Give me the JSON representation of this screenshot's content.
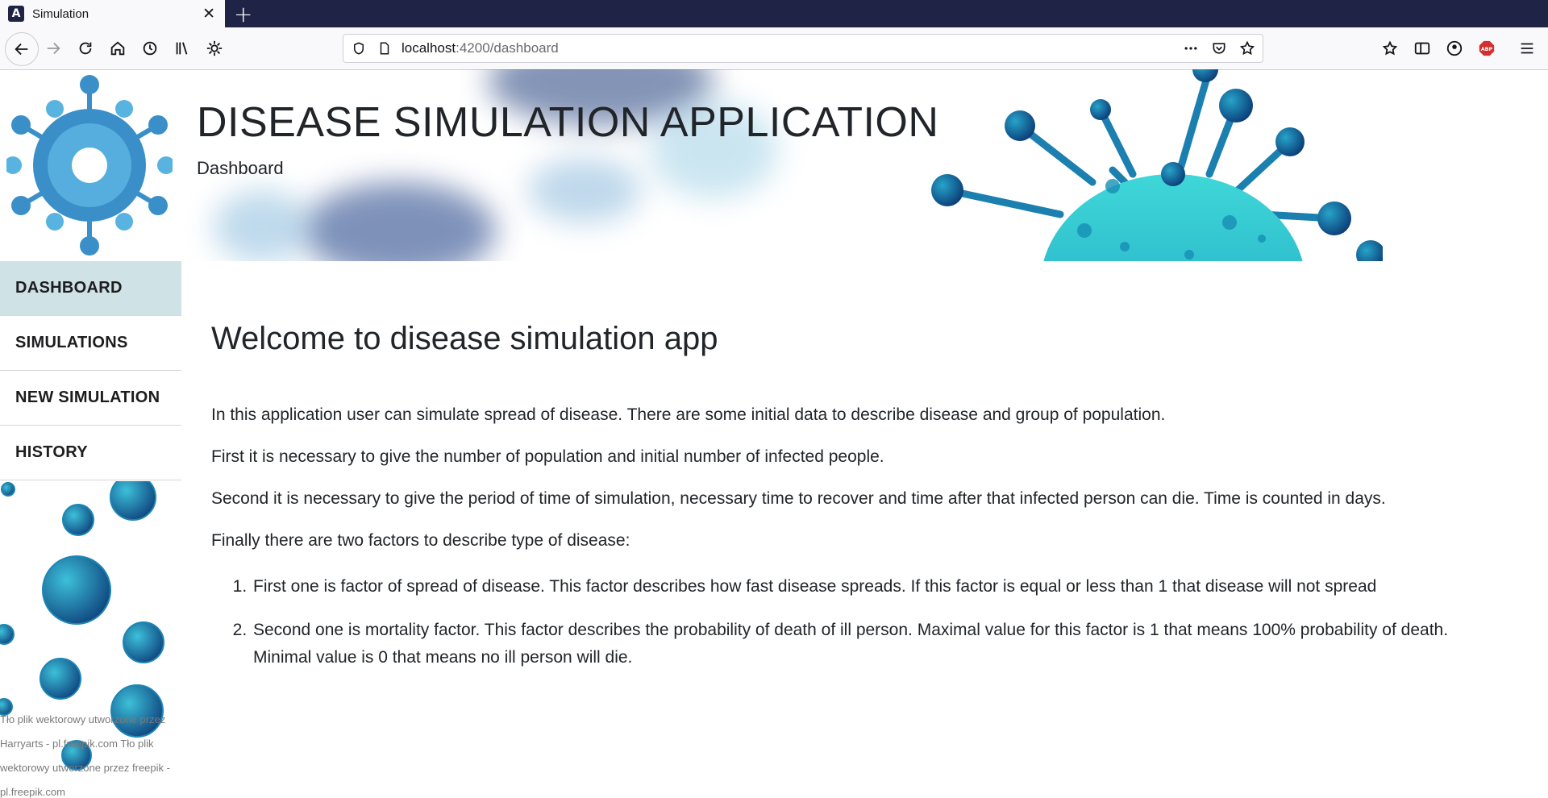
{
  "browser": {
    "tab_title": "Simulation",
    "url_host": "localhost",
    "url_rest": ":4200/dashboard"
  },
  "header": {
    "title": "DISEASE SIMULATION APPLICATION",
    "subtitle": "Dashboard"
  },
  "sidebar": {
    "items": [
      {
        "label": "DASHBOARD"
      },
      {
        "label": "SIMULATIONS"
      },
      {
        "label": "NEW SIMULATION"
      },
      {
        "label": "HISTORY"
      }
    ],
    "credit": "Tło plik wektorowy utworzone przez Harryarts - pl.freepik.com Tło plik wektorowy utworzone przez freepik - pl.freepik.com"
  },
  "main": {
    "heading": "Welcome to disease simulation app",
    "paragraphs": [
      "In this application user can simulate spread of disease. There are some initial data to describe disease and group of population.",
      "First it is necessary to give the number of population and initial number of infected people.",
      "Second it is necessary to give the period of time of simulation, necessary time to recover and time after that infected person can die. Time is counted in days.",
      "Finally there are two factors to describe type of disease:"
    ],
    "list": [
      "First one is factor of spread of disease. This factor describes how fast disease spreads. If this factor is equal or less than 1 that disease will not spread",
      "Second one is mortality factor. This factor describes the probability of death of ill person. Maximal value for this factor is 1 that means 100% probability of death. Minimal value is 0 that means no ill person will die."
    ]
  },
  "colors": {
    "tabbar": "#1f2345",
    "active_sidebar": "#cfe2e6",
    "virus_blue": "#3a8fc9",
    "virus_teal": "#2ec4d0"
  }
}
